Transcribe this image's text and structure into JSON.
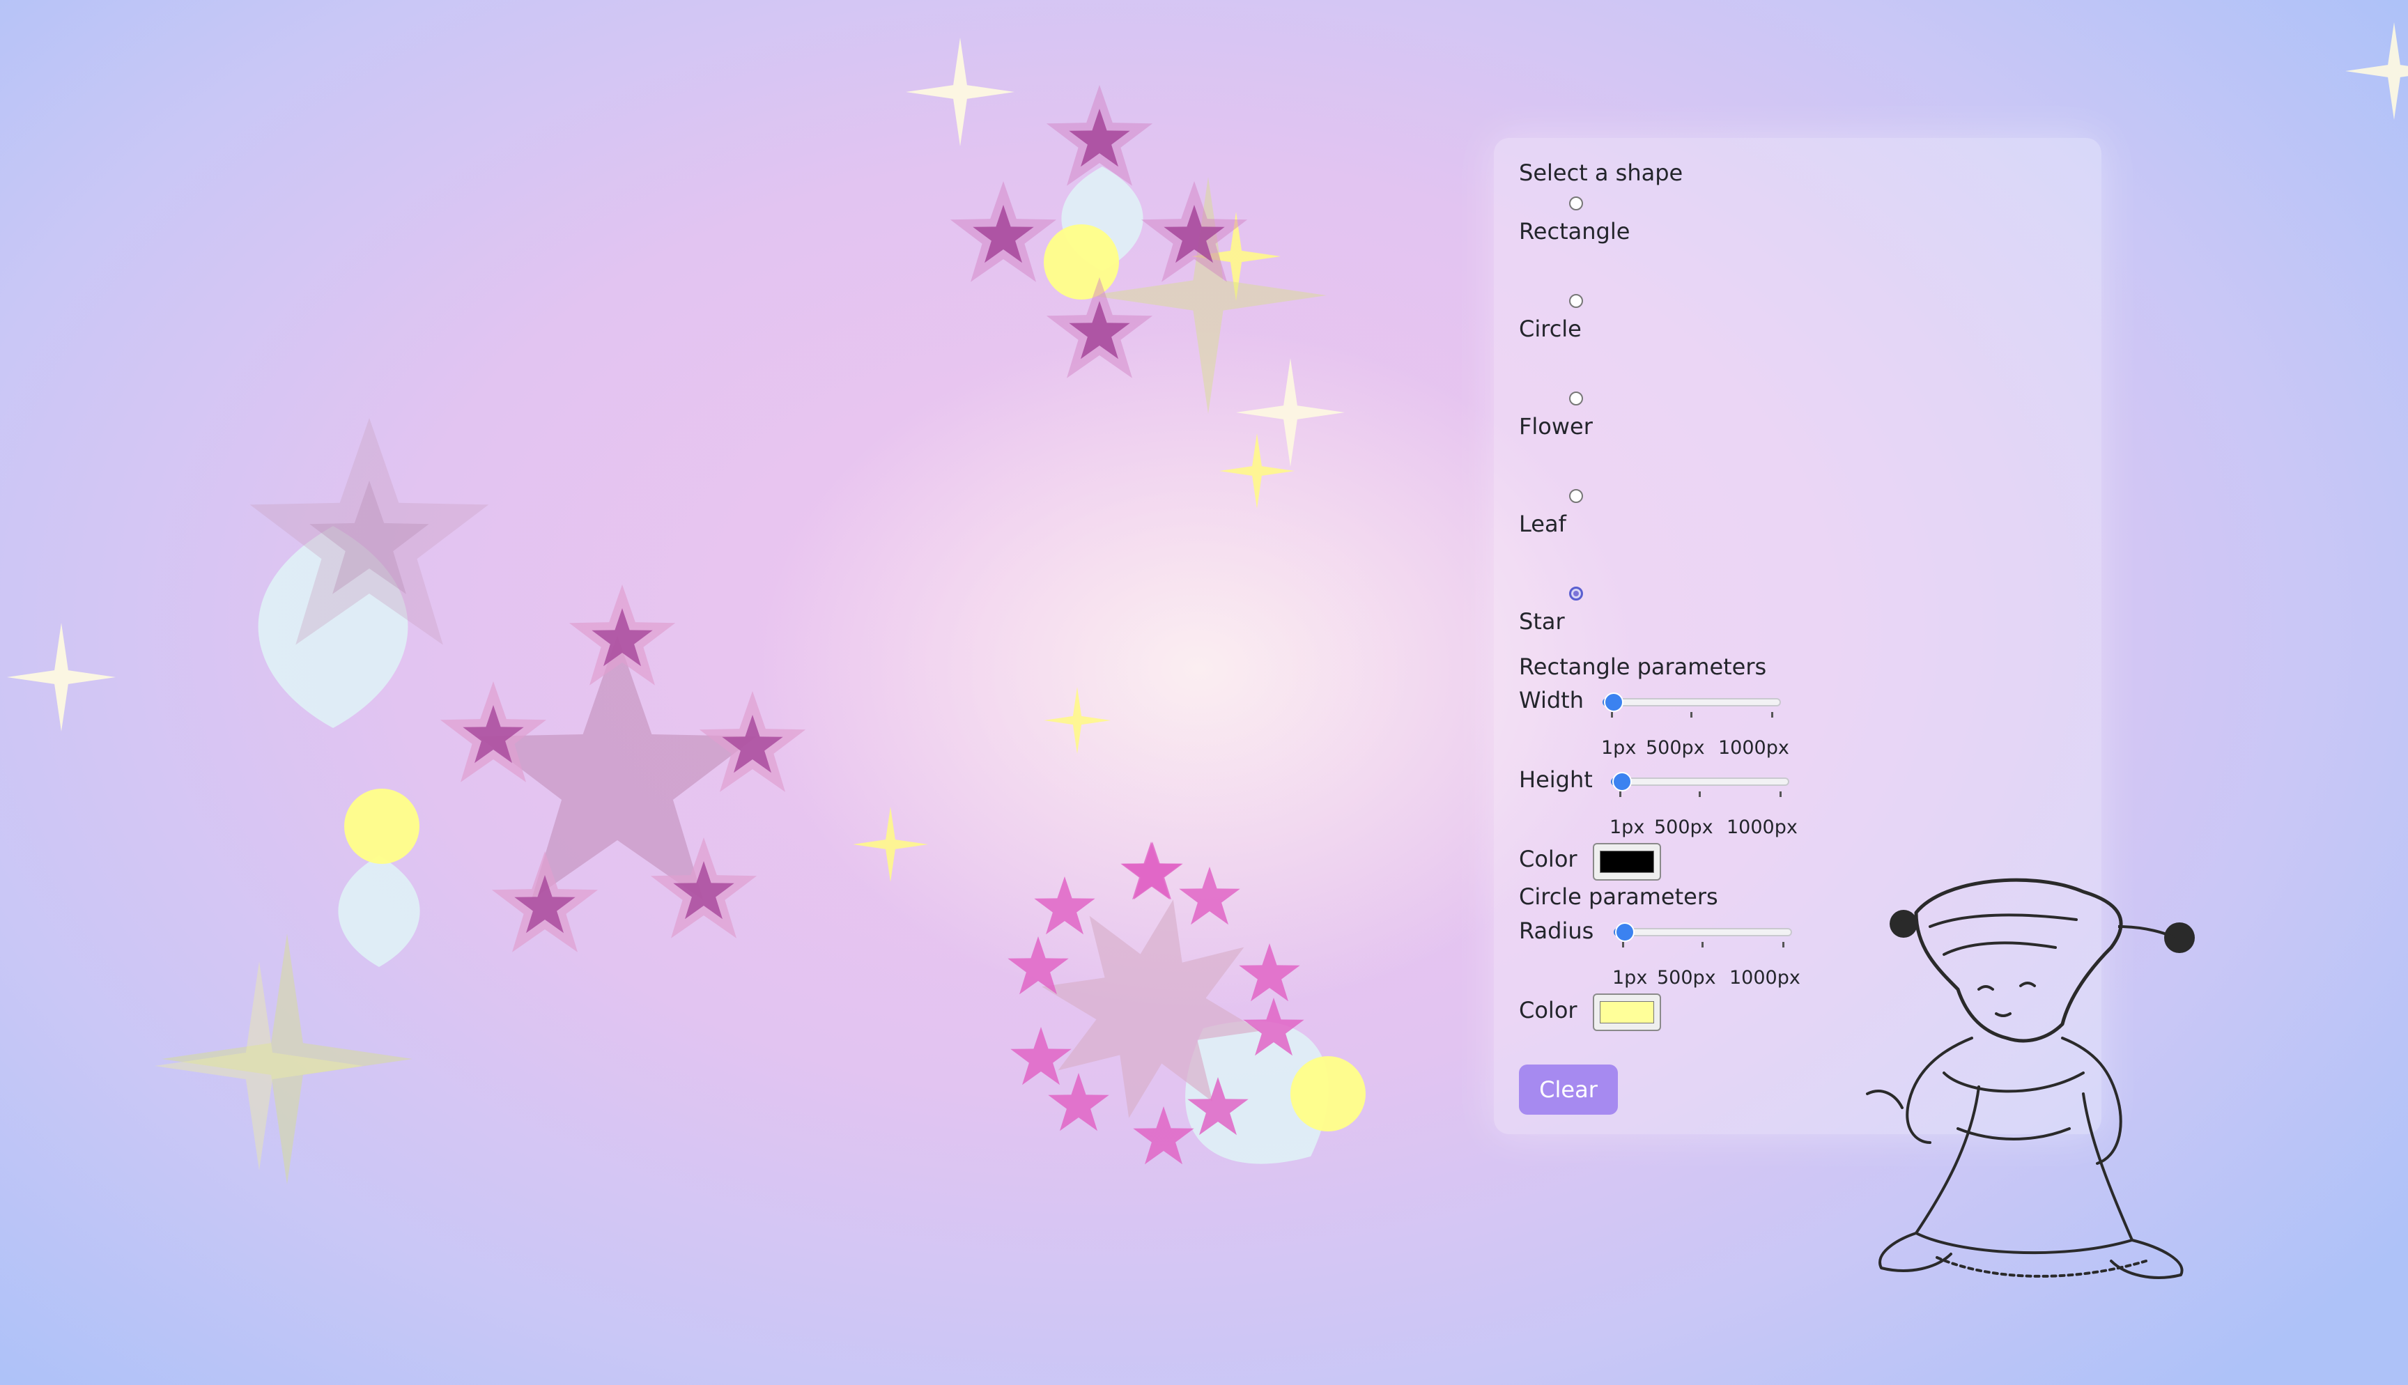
{
  "panel": {
    "heading": "Select a shape",
    "shapes": [
      {
        "label": "Rectangle",
        "checked": false
      },
      {
        "label": "Circle",
        "checked": false
      },
      {
        "label": "Flower",
        "checked": false
      },
      {
        "label": "Leaf",
        "checked": false
      },
      {
        "label": "Star",
        "checked": true
      }
    ],
    "rectangle": {
      "heading": "Rectangle parameters",
      "width_label": "Width",
      "height_label": "Height",
      "color_label": "Color",
      "color_value": "#000000",
      "ticks": [
        "1px",
        "500px",
        "1000px"
      ]
    },
    "circle": {
      "heading": "Circle parameters",
      "radius_label": "Radius",
      "color_label": "Color",
      "color_value": "#ffff99",
      "ticks": [
        "1px",
        "500px",
        "1000px"
      ]
    },
    "clear_label": "Clear"
  },
  "colors": {
    "radio_selected": "#7b73d8",
    "slider_accent": "#3b82f0",
    "clear_button": "#a68af0"
  }
}
